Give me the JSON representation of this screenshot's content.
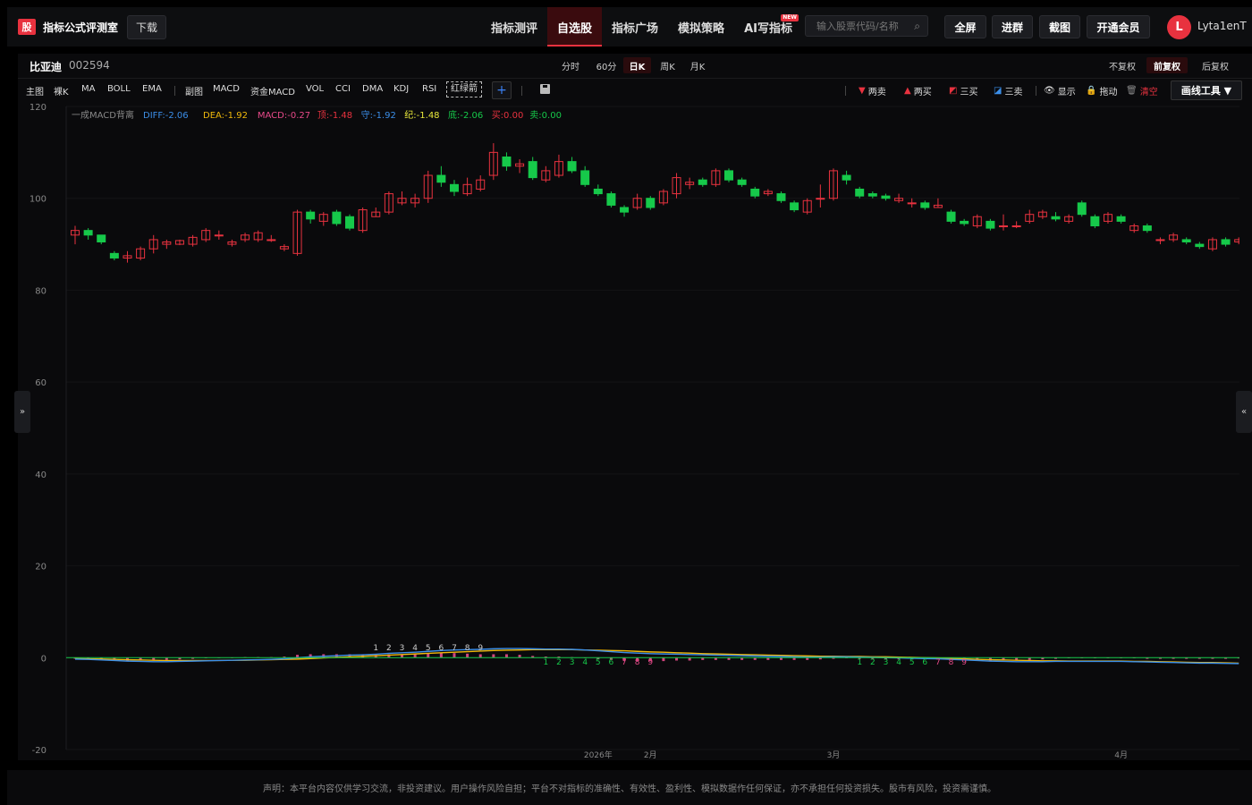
{
  "header": {
    "logo_char": "股",
    "app_title": "指标公式评测室",
    "download": "下载",
    "nav": [
      {
        "label": "指标测评",
        "active": false
      },
      {
        "label": "自选股",
        "active": true
      },
      {
        "label": "指标广场",
        "active": false
      },
      {
        "label": "模拟策略",
        "active": false
      },
      {
        "label": "AI写指标",
        "active": false,
        "badge": "NEW"
      }
    ],
    "search_placeholder": "输入股票代码/名称",
    "fullscreen": "全屏",
    "join_group": "进群",
    "screenshot": "截图",
    "membership": "开通会员",
    "avatar_letter": "L",
    "username": "Lyta1enT"
  },
  "stock": {
    "name": "比亚迪",
    "code": "002594"
  },
  "periods": [
    {
      "label": "分时",
      "active": false
    },
    {
      "label": "60分",
      "active": false
    },
    {
      "label": "日K",
      "active": true
    },
    {
      "label": "周K",
      "active": false
    },
    {
      "label": "月K",
      "active": false
    }
  ],
  "adjust": [
    {
      "label": "不复权",
      "active": false
    },
    {
      "label": "前复权",
      "active": true
    },
    {
      "label": "后复权",
      "active": false
    }
  ],
  "indicators_main": [
    "主图",
    "裸K",
    "MA",
    "BOLL",
    "EMA"
  ],
  "indicators_sub": [
    "副图",
    "MACD",
    "资金MACD",
    "VOL",
    "CCI",
    "DMA",
    "KDJ",
    "RSI"
  ],
  "indicator_dashed": "红绿箭",
  "tools": {
    "two_sell": "两卖",
    "two_buy": "两买",
    "three_buy": "三买",
    "three_sell": "三卖",
    "show": "显示",
    "drag": "拖动",
    "clear": "清空",
    "draw_tools": "画线工具 ▼"
  },
  "legend": {
    "name": "一成MACD背离",
    "items": [
      {
        "label": "DIFF:-2.06",
        "color": "#3b8ee8"
      },
      {
        "label": "DEA:-1.92",
        "color": "#f0b90b"
      },
      {
        "label": "MACD:-0.27",
        "color": "#e84a8a"
      },
      {
        "label": "顶:-1.48",
        "color": "#e8323f"
      },
      {
        "label": "守:-1.92",
        "color": "#3b8ee8"
      },
      {
        "label": "纪:-1.48",
        "color": "#e8e83b"
      },
      {
        "label": "底:-2.06",
        "color": "#16c94a"
      },
      {
        "label": "买:0.00",
        "color": "#e8323f"
      },
      {
        "label": "卖:0.00",
        "color": "#16c94a"
      }
    ]
  },
  "colors": {
    "up": "#e8323f",
    "down": "#16c94a",
    "bg": "#0a0a0c"
  },
  "chart_data": {
    "type": "candlestick",
    "ylim": [
      -20,
      120
    ],
    "yticks": [
      120,
      100,
      80,
      60,
      40,
      20,
      0,
      -20
    ],
    "xticks": [
      {
        "label": "2026年",
        "index": 40
      },
      {
        "label": "2月",
        "index": 44
      },
      {
        "label": "3月",
        "index": 58
      },
      {
        "label": "4月",
        "index": 80
      }
    ],
    "candles": [
      [
        92,
        93,
        90,
        94
      ],
      [
        93,
        92,
        91,
        93.5
      ],
      [
        92,
        90.5,
        90,
        92
      ],
      [
        88,
        87,
        86.5,
        88.5
      ],
      [
        87,
        87.5,
        86,
        88.5
      ],
      [
        87,
        89,
        86.5,
        89.5
      ],
      [
        89,
        91,
        88,
        92
      ],
      [
        90,
        90.5,
        89,
        91
      ],
      [
        90,
        90.8,
        89.8,
        91
      ],
      [
        90,
        91.5,
        89.5,
        92
      ],
      [
        91,
        93,
        90.5,
        93.5
      ],
      [
        92,
        92,
        91,
        93
      ],
      [
        90,
        90.5,
        89.5,
        91
      ],
      [
        91,
        92,
        90.5,
        92.5
      ],
      [
        91,
        92.5,
        90.5,
        93
      ],
      [
        91,
        91,
        90.5,
        92
      ],
      [
        89,
        89.5,
        88.5,
        90
      ],
      [
        88,
        97,
        87.5,
        97.5
      ],
      [
        97,
        95.5,
        94.5,
        97.5
      ],
      [
        95,
        96.5,
        94,
        97
      ],
      [
        97,
        94.5,
        94,
        97.5
      ],
      [
        96,
        93.5,
        93,
        96.5
      ],
      [
        93,
        97.5,
        92.5,
        98
      ],
      [
        96,
        97,
        96,
        98
      ],
      [
        97,
        101,
        96.5,
        101.5
      ],
      [
        99,
        100,
        98.5,
        101.5
      ],
      [
        99,
        100,
        98,
        101
      ],
      [
        100,
        105,
        99,
        106
      ],
      [
        105,
        103.5,
        102.5,
        107
      ],
      [
        103,
        101.5,
        100.5,
        104
      ],
      [
        101,
        103,
        100.5,
        104.5
      ],
      [
        102,
        104,
        101.5,
        105
      ],
      [
        105,
        110,
        104,
        112
      ],
      [
        109,
        107,
        106,
        110
      ],
      [
        107,
        107.5,
        105.5,
        108.5
      ],
      [
        108,
        104.5,
        104,
        109
      ],
      [
        104,
        106,
        103.5,
        107
      ],
      [
        105,
        108,
        104.5,
        109.5
      ],
      [
        108,
        106,
        105.5,
        109
      ],
      [
        106,
        103,
        102.5,
        107
      ],
      [
        102,
        101,
        100.5,
        103
      ],
      [
        101,
        98.5,
        98,
        101.5
      ],
      [
        98,
        97,
        96,
        98.5
      ],
      [
        98,
        100,
        97.5,
        101
      ],
      [
        100,
        98,
        97.5,
        100.5
      ],
      [
        99,
        101.5,
        98.5,
        102
      ],
      [
        101,
        104.5,
        100,
        105.5
      ],
      [
        103,
        103.5,
        102,
        104.5
      ],
      [
        104,
        103,
        102.5,
        104.5
      ],
      [
        103,
        106,
        102.5,
        106.5
      ],
      [
        106,
        104,
        103.5,
        106.5
      ],
      [
        104,
        103,
        102.5,
        104.5
      ],
      [
        102,
        100.5,
        100,
        102.5
      ],
      [
        101,
        101.5,
        100.5,
        102
      ],
      [
        101,
        99.5,
        99,
        101.5
      ],
      [
        99,
        97.5,
        97,
        99.5
      ],
      [
        97,
        99.5,
        96.5,
        100
      ],
      [
        100,
        100,
        98,
        103
      ],
      [
        100,
        106,
        99.5,
        106.5
      ],
      [
        105,
        104,
        103,
        106
      ],
      [
        102,
        100.5,
        100,
        102.5
      ],
      [
        101,
        100.5,
        100,
        101.5
      ],
      [
        100.5,
        100,
        99.5,
        101
      ],
      [
        99.5,
        100,
        99,
        101
      ],
      [
        99,
        99,
        98,
        100
      ],
      [
        99,
        98,
        97.5,
        99.5
      ],
      [
        98,
        98.5,
        98,
        100
      ],
      [
        97,
        95,
        94.5,
        97.5
      ],
      [
        95,
        94.5,
        94,
        95.5
      ],
      [
        94,
        96,
        93.5,
        96.5
      ],
      [
        95,
        93.5,
        93,
        95.5
      ],
      [
        94,
        94,
        93,
        96.5
      ],
      [
        94,
        94,
        93.5,
        95
      ],
      [
        95,
        96.5,
        94.5,
        97.5
      ],
      [
        96,
        97,
        95.5,
        97.5
      ],
      [
        96,
        95.5,
        95,
        97
      ],
      [
        95,
        96,
        94.5,
        96.5
      ],
      [
        99,
        96.5,
        96,
        99.5
      ],
      [
        96,
        94,
        93.5,
        96.5
      ],
      [
        95,
        96.5,
        94.5,
        97
      ],
      [
        96,
        95,
        94.5,
        96.5
      ],
      [
        93,
        94,
        92.5,
        94.5
      ],
      [
        94,
        93,
        92.5,
        94.5
      ],
      [
        91,
        91,
        90,
        91.5
      ],
      [
        91,
        92,
        90.5,
        92.5
      ],
      [
        91,
        90.5,
        90,
        91.5
      ],
      [
        90,
        89.5,
        89,
        90.5
      ],
      [
        89,
        91,
        88.5,
        91.5
      ],
      [
        91,
        90,
        89.5,
        91.5
      ],
      [
        90.5,
        91,
        90,
        91.5
      ],
      [
        91,
        90.5,
        90,
        91.5
      ]
    ],
    "macd": {
      "diff": [
        -0.5,
        -0.6,
        -0.8,
        -1,
        -1.2,
        -1.3,
        -1.4,
        -1.4,
        -1.3,
        -1.2,
        -1.1,
        -1,
        -0.9,
        -0.8,
        -0.7,
        -0.6,
        -0.4,
        0,
        0.3,
        0.5,
        0.7,
        0.9,
        1,
        1.2,
        1.5,
        1.7,
        1.9,
        2.2,
        2.5,
        2.7,
        2.8,
        2.9,
        3.1,
        3.2,
        3.2,
        3.1,
        3,
        3,
        2.9,
        2.7,
        2.4,
        2.1,
        1.8,
        1.6,
        1.4,
        1.3,
        1.2,
        1.1,
        1,
        0.9,
        0.8,
        0.7,
        0.6,
        0.5,
        0.4,
        0.3,
        0.2,
        0.2,
        0.3,
        0.3,
        0.2,
        0.1,
        0,
        -0.1,
        -0.2,
        -0.3,
        -0.4,
        -0.6,
        -0.8,
        -1,
        -1.2,
        -1.3,
        -1.4,
        -1.4,
        -1.4,
        -1.3,
        -1.3,
        -1.3,
        -1.3,
        -1.3,
        -1.3,
        -1.4,
        -1.5,
        -1.6,
        -1.7,
        -1.8,
        -1.9,
        -1.9,
        -2,
        -2.06
      ],
      "dea": [
        -0.3,
        -0.4,
        -0.5,
        -0.6,
        -0.7,
        -0.8,
        -0.9,
        -1,
        -1,
        -1,
        -1,
        -1,
        -0.9,
        -0.9,
        -0.8,
        -0.7,
        -0.6,
        -0.5,
        -0.3,
        -0.1,
        0.1,
        0.3,
        0.5,
        0.7,
        0.9,
        1.1,
        1.3,
        1.5,
        1.7,
        1.9,
        2.1,
        2.3,
        2.5,
        2.6,
        2.7,
        2.8,
        2.8,
        2.8,
        2.8,
        2.7,
        2.6,
        2.5,
        2.4,
        2.2,
        2,
        1.9,
        1.7,
        1.6,
        1.4,
        1.3,
        1.2,
        1.1,
        1,
        0.9,
        0.8,
        0.7,
        0.6,
        0.5,
        0.5,
        0.4,
        0.4,
        0.3,
        0.3,
        0.2,
        0.1,
        0,
        -0.1,
        -0.3,
        -0.4,
        -0.6,
        -0.7,
        -0.8,
        -0.9,
        -1,
        -1.1,
        -1.1,
        -1.2,
        -1.2,
        -1.2,
        -1.2,
        -1.2,
        -1.3,
        -1.3,
        -1.4,
        -1.5,
        -1.6,
        -1.7,
        -1.7,
        -1.8,
        -1.92
      ],
      "hist": [
        -0.4,
        -0.4,
        -0.6,
        -0.8,
        -1,
        -1,
        -1,
        -0.8,
        -0.6,
        -0.4,
        -0.2,
        0,
        0,
        0.2,
        0.2,
        0.2,
        0.4,
        1,
        1.2,
        1.2,
        1.2,
        1.2,
        1,
        1,
        1.2,
        1.2,
        1.2,
        1.4,
        1.6,
        1.6,
        1.4,
        1.2,
        1.2,
        1.2,
        1,
        0.6,
        0.4,
        0.4,
        0.2,
        0,
        -0.4,
        -0.8,
        -1.2,
        -1.2,
        -1.2,
        -1.2,
        -1,
        -1,
        -0.8,
        -0.8,
        -0.8,
        -0.8,
        -0.8,
        -0.8,
        -0.8,
        -0.8,
        -0.8,
        -0.6,
        -0.4,
        -0.2,
        -0.4,
        -0.4,
        -0.6,
        -0.6,
        -0.6,
        -0.6,
        -0.6,
        -0.6,
        -0.8,
        -0.8,
        -1,
        -1,
        -1,
        -0.8,
        -0.6,
        -0.4,
        -0.2,
        -0.2,
        -0.2,
        -0.2,
        -0.2,
        -0.2,
        -0.4,
        -0.4,
        -0.4,
        -0.4,
        -0.4,
        -0.4,
        -0.4,
        -0.27
      ],
      "up_marks": [
        {
          "i": 23,
          "n": "1"
        },
        {
          "i": 24,
          "n": "2"
        },
        {
          "i": 25,
          "n": "3"
        },
        {
          "i": 26,
          "n": "4"
        },
        {
          "i": 27,
          "n": "5"
        },
        {
          "i": 28,
          "n": "6"
        },
        {
          "i": 29,
          "n": "7"
        },
        {
          "i": 30,
          "n": "8"
        },
        {
          "i": 31,
          "n": "9"
        }
      ],
      "down_marks": [
        {
          "i": 36,
          "n": "1"
        },
        {
          "i": 37,
          "n": "2"
        },
        {
          "i": 38,
          "n": "3"
        },
        {
          "i": 39,
          "n": "4"
        },
        {
          "i": 40,
          "n": "5"
        },
        {
          "i": 41,
          "n": "6"
        },
        {
          "i": 42,
          "n": "7"
        },
        {
          "i": 43,
          "n": "8"
        },
        {
          "i": 44,
          "n": "9"
        },
        {
          "i": 60,
          "n": "1"
        },
        {
          "i": 61,
          "n": "2"
        },
        {
          "i": 62,
          "n": "3"
        },
        {
          "i": 63,
          "n": "4"
        },
        {
          "i": 64,
          "n": "5"
        },
        {
          "i": 65,
          "n": "6"
        },
        {
          "i": 66,
          "n": "7"
        },
        {
          "i": 67,
          "n": "8"
        },
        {
          "i": 68,
          "n": "9"
        }
      ]
    }
  },
  "footer": "声明：本平台内容仅供学习交流，非投资建议。用户操作风险自担；平台不对指标的准确性、有效性、盈利性、模拟数据作任何保证，亦不承担任何投资损失。股市有风险，投资需谨慎。"
}
